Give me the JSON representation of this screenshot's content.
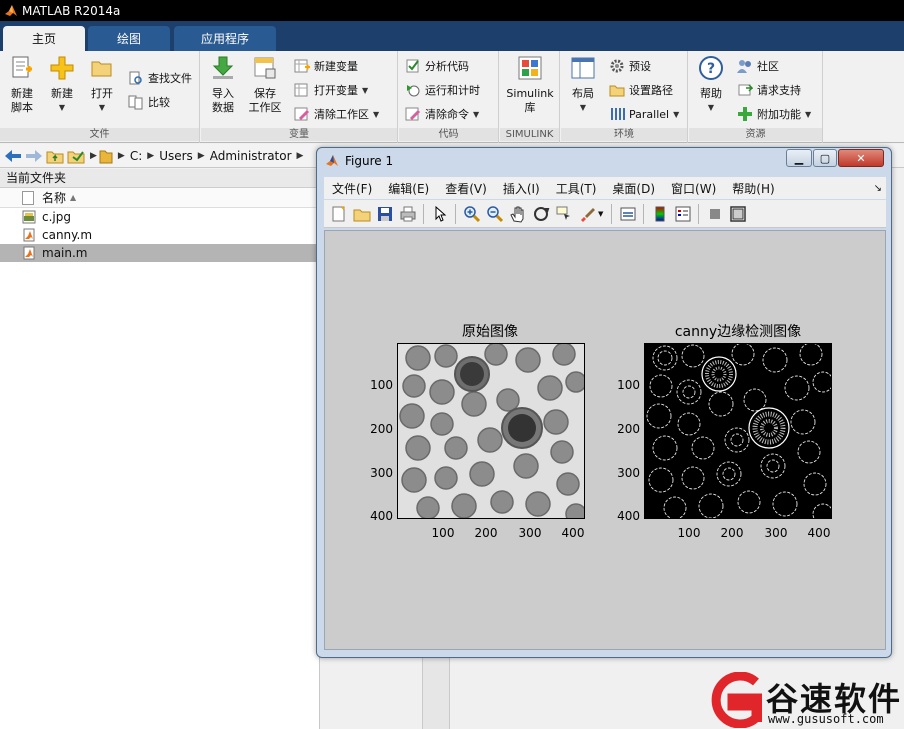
{
  "app": {
    "title": "MATLAB R2014a"
  },
  "ribbon_tabs": [
    "主页",
    "绘图",
    "应用程序"
  ],
  "file_group": {
    "label": "文件",
    "new_script": "新建\n脚本",
    "new": "新建",
    "open": "打开",
    "find_files": "查找文件",
    "compare": "比较"
  },
  "variable_group": {
    "label": "变量",
    "import_data": "导入\n数据",
    "save_workspace": "保存\n工作区",
    "new_variable": "新建变量",
    "open_variable": "打开变量",
    "clear_workspace": "清除工作区"
  },
  "code_group": {
    "label": "代码",
    "analyze_code": "分析代码",
    "run_and_time": "运行和计时",
    "clear_commands": "清除命令"
  },
  "simulink_group": {
    "label": "SIMULINK",
    "simulink_library": "Simulink\n库"
  },
  "environment_group": {
    "label": "环境",
    "layout": "布局",
    "preferences": "预设",
    "set_path": "设置路径",
    "parallel": "Parallel"
  },
  "resources_group": {
    "label": "资源",
    "help": "帮助",
    "community": "社区",
    "request_support": "请求支持",
    "add_ons": "附加功能"
  },
  "address": {
    "crumbs": [
      "C:",
      "Users",
      "Administrator"
    ]
  },
  "folder_panel": {
    "title": "当前文件夹",
    "column_name": "名称",
    "files": [
      {
        "name": "c.jpg",
        "icon": "jpg-file-icon"
      },
      {
        "name": "canny.m",
        "icon": "m-file-icon"
      },
      {
        "name": "main.m",
        "icon": "m-file-icon",
        "selected": true
      }
    ]
  },
  "figure": {
    "title": "Figure 1",
    "menus": [
      "文件(F)",
      "编辑(E)",
      "查看(V)",
      "插入(I)",
      "工具(T)",
      "桌面(D)",
      "窗口(W)",
      "帮助(H)"
    ],
    "axes": [
      {
        "title": "原始图像",
        "yticks": [
          "100",
          "200",
          "300",
          "400"
        ],
        "xticks": [
          "100",
          "200",
          "300",
          "400"
        ]
      },
      {
        "title": "canny边缘检测图像",
        "yticks": [
          "100",
          "200",
          "300",
          "400"
        ],
        "xticks": [
          "100",
          "200",
          "300",
          "400"
        ]
      }
    ]
  },
  "watermark": {
    "text": "谷速软件",
    "url": "www.gususoft.com",
    "color": "#e0252b"
  },
  "colors": {
    "ribbon_tab_bg": "#1c3f6b",
    "figure_bg": "#cccccc",
    "selected_row": "#b4b4b4"
  }
}
